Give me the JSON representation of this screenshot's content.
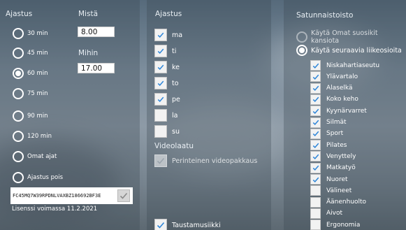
{
  "colors": {
    "accent_check": "#2f86d8",
    "panel": "rgba(55,68,80,0.30)"
  },
  "schedule": {
    "header": "Ajastus",
    "options": [
      {
        "label": "30 min",
        "selected": false
      },
      {
        "label": "45 min",
        "selected": false
      },
      {
        "label": "60 min",
        "selected": true
      },
      {
        "label": "75 min",
        "selected": false
      },
      {
        "label": "90 min",
        "selected": false
      },
      {
        "label": "120 min",
        "selected": false
      },
      {
        "label": "Omat ajat",
        "selected": false
      },
      {
        "label": "Ajastus pois",
        "selected": false
      }
    ],
    "from": {
      "label": "Mistä",
      "value": "8.00"
    },
    "to": {
      "label": "Mihin",
      "value": "17.00"
    },
    "license_key": "FC45MQ7W39RPDNLVAXBZ186692BF3E",
    "license_text": "Lisenssi voimassa 11.2.2021"
  },
  "days": {
    "header": "Ajastus",
    "items": [
      {
        "label": "ma",
        "checked": true
      },
      {
        "label": "ti",
        "checked": true
      },
      {
        "label": "ke",
        "checked": true
      },
      {
        "label": "to",
        "checked": true
      },
      {
        "label": "pe",
        "checked": true
      },
      {
        "label": "la",
        "checked": false
      },
      {
        "label": "su",
        "checked": false
      }
    ]
  },
  "video": {
    "header": "Videolaatu",
    "traditional_label": "Perinteinen videopakkaus",
    "traditional_checked": true,
    "music_label": "Taustamusiikki",
    "music_checked": true
  },
  "random": {
    "header": "Satunnaistoisto",
    "options": [
      {
        "label": "Käytä Omat suosikit kansiota",
        "selected": false,
        "disabled": true
      },
      {
        "label": "Käytä seuraavia liikeosioita",
        "selected": true,
        "disabled": false
      }
    ],
    "sections": [
      {
        "label": "Niskahartiaseutu",
        "checked": true
      },
      {
        "label": "Ylävartalo",
        "checked": true
      },
      {
        "label": "Alaselkä",
        "checked": true
      },
      {
        "label": "Koko keho",
        "checked": true
      },
      {
        "label": "Kyynärvarret",
        "checked": true
      },
      {
        "label": "Silmät",
        "checked": true
      },
      {
        "label": "Sport",
        "checked": true
      },
      {
        "label": "Pilates",
        "checked": true
      },
      {
        "label": "Venyttely",
        "checked": true
      },
      {
        "label": "Matkatyö",
        "checked": true
      },
      {
        "label": "Nuoret",
        "checked": true
      },
      {
        "label": "Välineet",
        "checked": false
      },
      {
        "label": "Äänenhuolto",
        "checked": false
      },
      {
        "label": "Aivot",
        "checked": false
      },
      {
        "label": "Ergonomia",
        "checked": false
      }
    ]
  }
}
